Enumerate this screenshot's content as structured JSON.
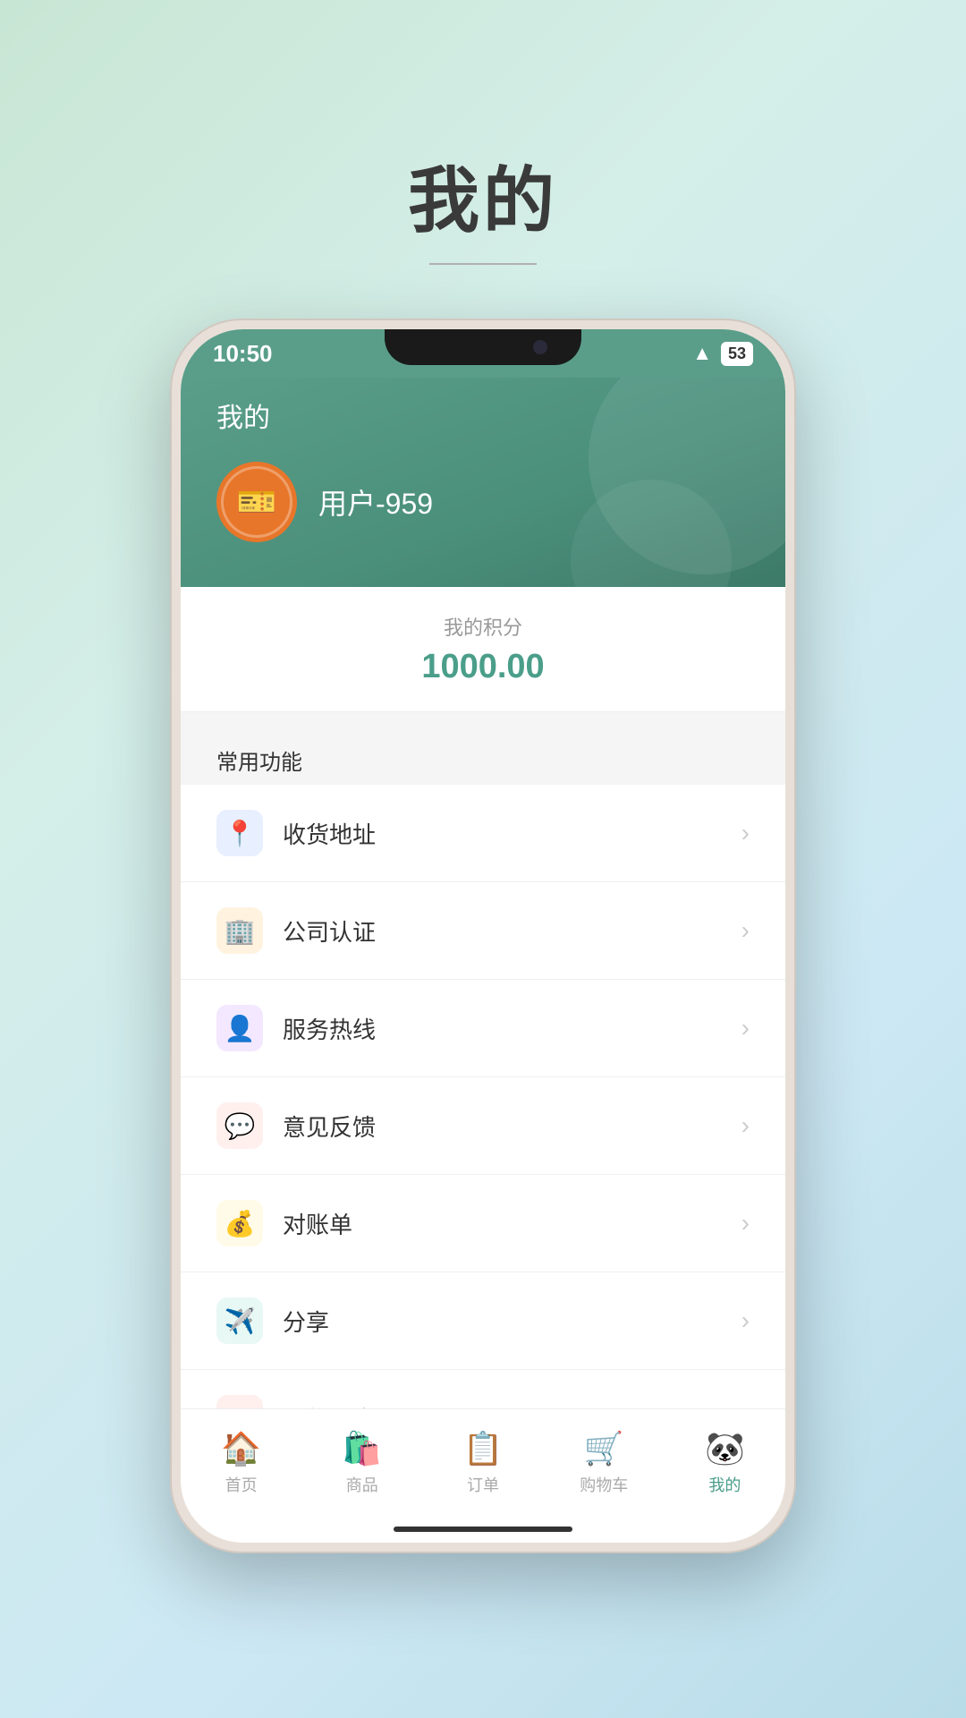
{
  "page": {
    "title": "我的",
    "title_divider": true
  },
  "status_bar": {
    "time": "10:50",
    "battery": "53"
  },
  "header": {
    "title": "我的",
    "username": "用户-959"
  },
  "points": {
    "label": "我的积分",
    "value": "1000.00"
  },
  "common_functions": {
    "section_title": "常用功能",
    "items": [
      {
        "id": "address",
        "label": "收货地址",
        "icon": "📍",
        "icon_class": "icon-blue"
      },
      {
        "id": "company",
        "label": "公司认证",
        "icon": "🏢",
        "icon_class": "icon-orange"
      },
      {
        "id": "service",
        "label": "服务热线",
        "icon": "👤",
        "icon_class": "icon-purple"
      },
      {
        "id": "feedback",
        "label": "意见反馈",
        "icon": "💬",
        "icon_class": "icon-red"
      },
      {
        "id": "statement",
        "label": "对账单",
        "icon": "💰",
        "icon_class": "icon-yellow"
      },
      {
        "id": "share",
        "label": "分享",
        "icon": "✈️",
        "icon_class": "icon-teal"
      },
      {
        "id": "payment",
        "label": "付款信息",
        "icon": "¥",
        "icon_class": "icon-red"
      }
    ]
  },
  "bottom_nav": {
    "items": [
      {
        "id": "home",
        "label": "首页",
        "icon": "🏠",
        "active": false
      },
      {
        "id": "products",
        "label": "商品",
        "icon": "🛍️",
        "active": false
      },
      {
        "id": "orders",
        "label": "订单",
        "icon": "📋",
        "active": false
      },
      {
        "id": "cart",
        "label": "购物车",
        "icon": "🛒",
        "active": false
      },
      {
        "id": "mine",
        "label": "我的",
        "icon": "🐼",
        "active": true
      }
    ]
  }
}
